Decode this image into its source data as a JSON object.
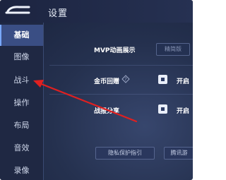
{
  "header": {
    "title": "设置",
    "back_icon": "back-arrow-icon"
  },
  "sidebar": {
    "items": [
      {
        "label": "基础",
        "active": true
      },
      {
        "label": "图像",
        "active": false
      },
      {
        "label": "战斗",
        "active": false
      },
      {
        "label": "操作",
        "active": false
      },
      {
        "label": "布局",
        "active": false
      },
      {
        "label": "音效",
        "active": false
      },
      {
        "label": "录像",
        "active": false
      }
    ]
  },
  "main": {
    "mvp_animation_label": "MVP动画展示",
    "mvp_animation_value": "精简版",
    "gold_replay_label": "金币回赠",
    "gold_replay_help_icon": "question-icon",
    "gold_replay_toggle_label": "开启",
    "gold_replay_enabled": true,
    "battle_share_label": "战报分享",
    "battle_share_toggle_label": "开启",
    "battle_share_enabled": true,
    "privacy_button_label": "隐私保护指引",
    "tencent_button_label": "腾讯游"
  },
  "annotation": {
    "arrow_color": "#e02020",
    "arrow_icon": "red-pointer-arrow"
  },
  "colors": {
    "background": "#25314f",
    "sidebar_active": "#3a4e84",
    "accent": "#79a8ff"
  }
}
